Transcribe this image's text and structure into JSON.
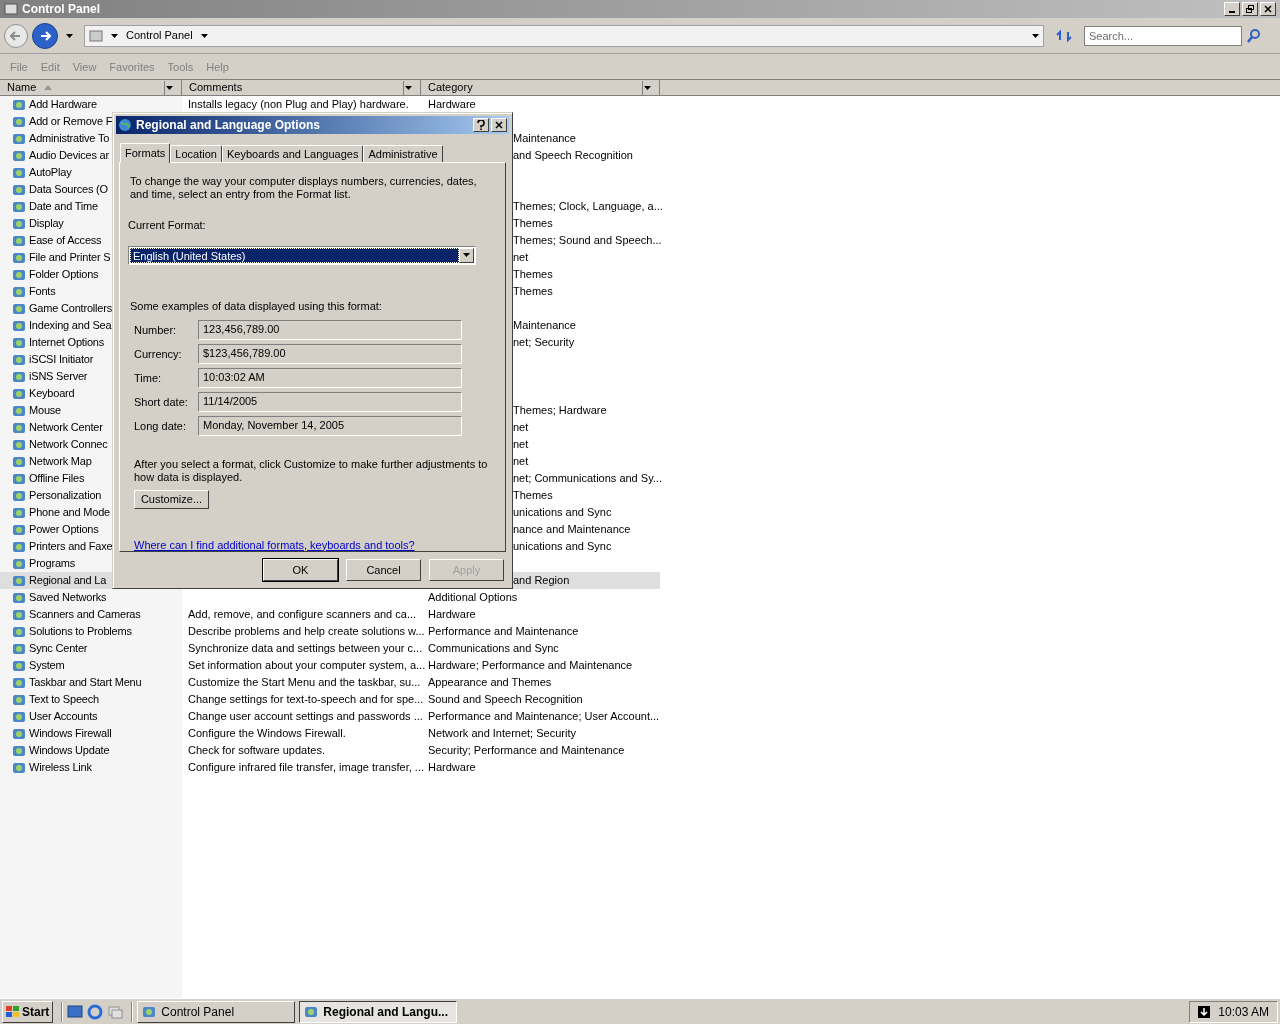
{
  "window": {
    "title": "Control Panel"
  },
  "address": {
    "location": "Control Panel",
    "search_placeholder": "Search..."
  },
  "menu": [
    "File",
    "Edit",
    "View",
    "Favorites",
    "Tools",
    "Help"
  ],
  "columns": [
    {
      "label": "Name",
      "sorted": true
    },
    {
      "label": "Comments",
      "sorted": false
    },
    {
      "label": "Category",
      "sorted": false
    }
  ],
  "rows": [
    {
      "name": "Add Hardware",
      "comment": "Installs legacy (non Plug and Play) hardware.",
      "category": "Hardware",
      "selected": false,
      "covered": false
    },
    {
      "name": "Add or Remove F",
      "selected": false
    },
    {
      "name": "Administrative To",
      "category": "Maintenance",
      "selected": false,
      "covered": true
    },
    {
      "name": "Audio Devices ar",
      "category": "and Speech Recognition",
      "selected": false,
      "covered": true
    },
    {
      "name": "AutoPlay",
      "selected": false
    },
    {
      "name": "Data Sources (O",
      "selected": false
    },
    {
      "name": "Date and Time",
      "category": "Themes; Clock, Language, a...",
      "selected": false,
      "covered": true
    },
    {
      "name": "Display",
      "category": "Themes",
      "selected": false,
      "covered": true
    },
    {
      "name": "Ease of Access",
      "category": "Themes; Sound and Speech...",
      "selected": false,
      "covered": true
    },
    {
      "name": "File and Printer S",
      "category": "net",
      "selected": false,
      "covered": true
    },
    {
      "name": "Folder Options",
      "category": "Themes",
      "selected": false,
      "covered": true
    },
    {
      "name": "Fonts",
      "category": "Themes",
      "selected": false,
      "covered": true
    },
    {
      "name": "Game Controllers",
      "selected": false
    },
    {
      "name": "Indexing and Sea",
      "category": "Maintenance",
      "selected": false,
      "covered": true
    },
    {
      "name": "Internet Options",
      "category": "net; Security",
      "selected": false,
      "covered": true
    },
    {
      "name": "iSCSI Initiator",
      "selected": false
    },
    {
      "name": "iSNS Server",
      "selected": false
    },
    {
      "name": "Keyboard",
      "selected": false
    },
    {
      "name": "Mouse",
      "category": "Themes; Hardware",
      "selected": false,
      "covered": true
    },
    {
      "name": "Network Center",
      "category": "net",
      "selected": false,
      "covered": true
    },
    {
      "name": "Network Connec",
      "category": "net",
      "selected": false,
      "covered": true
    },
    {
      "name": "Network Map",
      "category": "net",
      "selected": false,
      "covered": true
    },
    {
      "name": "Offline Files",
      "category": "net; Communications and Sy...",
      "selected": false,
      "covered": true
    },
    {
      "name": "Personalization",
      "category": "Themes",
      "selected": false,
      "covered": true
    },
    {
      "name": "Phone and Mode",
      "category": "unications and Sync",
      "selected": false,
      "covered": true
    },
    {
      "name": "Power Options",
      "category": "nance and Maintenance",
      "selected": false,
      "covered": true
    },
    {
      "name": "Printers and Faxe",
      "category": "unications and Sync",
      "selected": false,
      "covered": true
    },
    {
      "name": "Programs",
      "selected": false
    },
    {
      "name": "Regional and La",
      "category": "and Region",
      "selected": true,
      "covered": true
    },
    {
      "name": "Saved Networks",
      "category": "Additional Options",
      "selected": false,
      "covered": false
    },
    {
      "name": "Scanners and Cameras",
      "comment": "Add, remove, and configure scanners and ca...",
      "category": "Hardware",
      "selected": false,
      "covered": false
    },
    {
      "name": "Solutions to Problems",
      "comment": "Describe problems and help create solutions w...",
      "category": "Performance and Maintenance",
      "selected": false,
      "covered": false
    },
    {
      "name": "Sync Center",
      "comment": "Synchronize data and settings between your c...",
      "category": "Communications and Sync",
      "selected": false,
      "covered": false
    },
    {
      "name": "System",
      "comment": "Set information about your computer system, a...",
      "category": "Hardware; Performance and Maintenance",
      "selected": false,
      "covered": false
    },
    {
      "name": "Taskbar and Start Menu",
      "comment": "Customize the Start Menu and the taskbar, su...",
      "category": "Appearance and Themes",
      "selected": false,
      "covered": false
    },
    {
      "name": "Text to Speech",
      "comment": "Change settings for text-to-speech and for spe...",
      "category": "Sound and Speech Recognition",
      "selected": false,
      "covered": false
    },
    {
      "name": "User Accounts",
      "comment": "Change user account settings and passwords ...",
      "category": "Performance and Maintenance; User Account...",
      "selected": false,
      "covered": false
    },
    {
      "name": "Windows Firewall",
      "comment": "Configure the Windows Firewall.",
      "category": "Network and Internet; Security",
      "selected": false,
      "covered": false
    },
    {
      "name": "Windows Update",
      "comment": "Check for software updates.",
      "category": "Security; Performance and Maintenance",
      "selected": false,
      "covered": false
    },
    {
      "name": "Wireless Link",
      "comment": "Configure infrared file transfer, image transfer, ...",
      "category": "Hardware",
      "selected": false,
      "covered": false
    }
  ],
  "dialog": {
    "title": "Regional and Language Options",
    "tabs": [
      {
        "label": "Formats",
        "selected": true
      },
      {
        "label": "Location",
        "selected": false
      },
      {
        "label": "Keyboards and Languages",
        "selected": false
      },
      {
        "label": "Administrative",
        "selected": false
      }
    ],
    "intro": "To change the way your computer displays numbers, currencies, dates, and time, select an entry from the Format list.",
    "format_label": "Current Format:",
    "format_value": "English (United States)",
    "examples_label": "Some examples of data displayed using this format:",
    "examples": [
      {
        "label": "Number:",
        "value": "123,456,789.00"
      },
      {
        "label": "Currency:",
        "value": "$123,456,789.00"
      },
      {
        "label": "Time:",
        "value": "10:03:02 AM"
      },
      {
        "label": "Short date:",
        "value": "11/14/2005"
      },
      {
        "label": "Long date:",
        "value": "Monday, November 14, 2005"
      }
    ],
    "customize_text": "After you select a format, click Customize to make further adjustments to how data is displayed.",
    "customize_button": "Customize...",
    "link": "Where can I find additional formats, keyboards and tools?",
    "buttons": [
      {
        "label": "OK",
        "disabled": false
      },
      {
        "label": "Cancel",
        "disabled": false
      },
      {
        "label": "Apply",
        "disabled": true
      }
    ]
  },
  "taskbar": {
    "start": "Start",
    "tasks": [
      {
        "label": "Control Panel",
        "selected": false
      },
      {
        "label": "Regional and Langu...",
        "selected": true
      }
    ],
    "clock": "10:03 AM"
  }
}
